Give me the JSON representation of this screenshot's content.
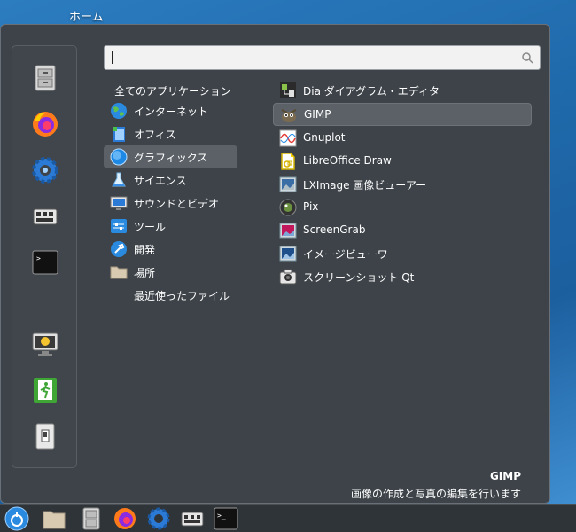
{
  "desktop": {
    "label": "ホーム"
  },
  "search": {
    "value": "",
    "placeholder": ""
  },
  "categories": {
    "header": "全てのアプリケーション",
    "items": [
      {
        "label": "インターネット",
        "icon": "globe-icon"
      },
      {
        "label": "オフィス",
        "icon": "office-icon"
      },
      {
        "label": "グラフィックス",
        "icon": "graphics-icon",
        "active": true
      },
      {
        "label": "サイエンス",
        "icon": "flask-icon"
      },
      {
        "label": "サウンドとビデオ",
        "icon": "multimedia-icon"
      },
      {
        "label": "ツール",
        "icon": "tools-icon"
      },
      {
        "label": "開発",
        "icon": "development-icon"
      },
      {
        "label": "場所",
        "icon": "folder-icon"
      },
      {
        "label": "最近使ったファイル",
        "icon": ""
      }
    ]
  },
  "apps": [
    {
      "label": "Dia ダイアグラム・エディタ",
      "icon": "dia-icon"
    },
    {
      "label": "GIMP",
      "icon": "gimp-icon",
      "active": true
    },
    {
      "label": "Gnuplot",
      "icon": "gnuplot-icon"
    },
    {
      "label": "LibreOffice Draw",
      "icon": "libreoffice-draw-icon"
    },
    {
      "label": "LXImage 画像ビューアー",
      "icon": "lximage-icon"
    },
    {
      "label": "Pix",
      "icon": "pix-icon"
    },
    {
      "label": "ScreenGrab",
      "icon": "screengrab-icon"
    },
    {
      "label": "イメージビューワ",
      "icon": "image-viewer-icon"
    },
    {
      "label": "スクリーンショット Qt",
      "icon": "screenshot-icon"
    }
  ],
  "description": {
    "title": "GIMP",
    "text": "画像の作成と写真の編集を行います"
  }
}
